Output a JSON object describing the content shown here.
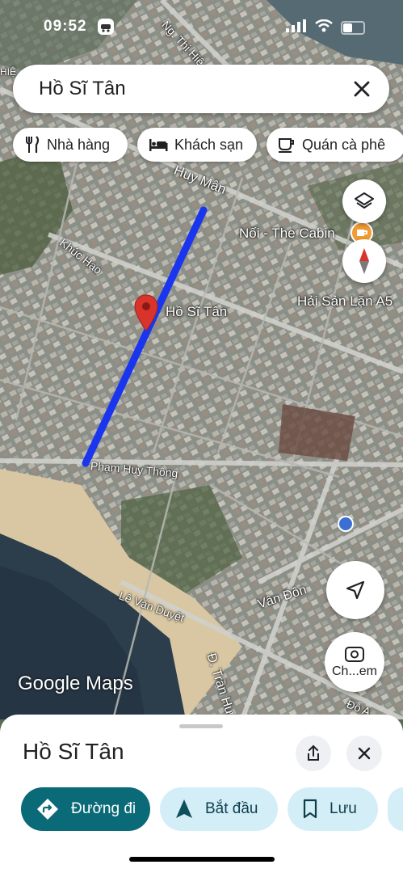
{
  "status": {
    "time": "09:52"
  },
  "search": {
    "query": "Hồ Sĩ Tân"
  },
  "chips": [
    {
      "label": "Nhà hàng",
      "icon": "fork-knife-icon"
    },
    {
      "label": "Khách sạn",
      "icon": "bed-icon"
    },
    {
      "label": "Quán cà phê",
      "icon": "coffee-cup-icon"
    }
  ],
  "map": {
    "selected_label": "Hồ Sĩ Tân",
    "poi": [
      "Nối - The Cabin",
      "Hải Sản Lặn A5"
    ],
    "streets": [
      "Ng. Thị Hiệ",
      "Huy Mân",
      "Khúc Hạo",
      "Phạm Huy Thông",
      "Lê Văn Duyệt",
      "Vân Đồn",
      "Đ. Trần Hư",
      "Đỗ A",
      "HIỆ"
    ],
    "logo": "Google Maps",
    "route_color": "#1a35f0",
    "pin_color": "#d9342b"
  },
  "buttons": {
    "streetview_label": "Ch...em"
  },
  "sheet": {
    "title": "Hồ Sĩ Tân",
    "actions": [
      {
        "label": "Đường đi",
        "style": "primary"
      },
      {
        "label": "Bắt đầu",
        "style": "secondary"
      },
      {
        "label": "Lưu",
        "style": "secondary"
      }
    ],
    "primary_color": "#0b6a77",
    "secondary_color": "#d4eef8"
  }
}
